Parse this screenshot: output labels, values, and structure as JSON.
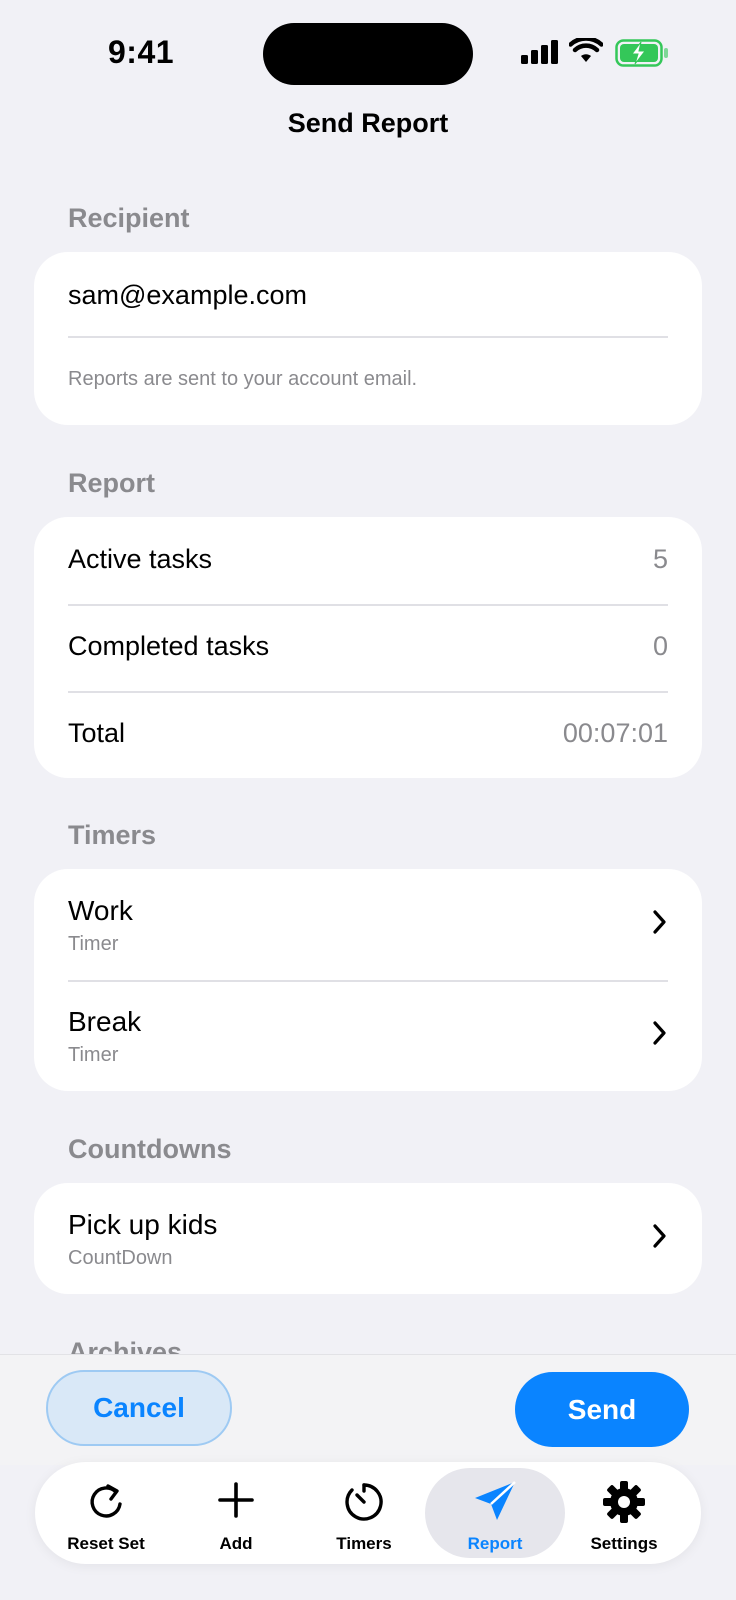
{
  "status_bar": {
    "time": "9:41"
  },
  "nav": {
    "title": "Send Report"
  },
  "recipient": {
    "header": "Recipient",
    "email": "sam@example.com",
    "hint": "Reports are sent to your account email."
  },
  "report": {
    "header": "Report",
    "rows": [
      {
        "label": "Active tasks",
        "value": "5"
      },
      {
        "label": "Completed tasks",
        "value": "0"
      },
      {
        "label": "Total",
        "value": "00:07:01"
      }
    ]
  },
  "timers": {
    "header": "Timers",
    "items": [
      {
        "title": "Work",
        "subtitle": "Timer"
      },
      {
        "title": "Break",
        "subtitle": "Timer"
      }
    ]
  },
  "countdowns": {
    "header": "Countdowns",
    "items": [
      {
        "title": "Pick up kids",
        "subtitle": "CountDown"
      }
    ]
  },
  "archives": {
    "header": "Archives"
  },
  "actions": {
    "cancel": "Cancel",
    "send": "Send"
  },
  "tabbar": {
    "tabs": [
      {
        "label": "Reset Set",
        "icon": "reset-icon"
      },
      {
        "label": "Add",
        "icon": "plus-icon"
      },
      {
        "label": "Timers",
        "icon": "timer-icon"
      },
      {
        "label": "Report",
        "icon": "paper-plane-icon",
        "active": true
      },
      {
        "label": "Settings",
        "icon": "gear-icon"
      }
    ]
  },
  "colors": {
    "accent": "#0a84ff",
    "background": "#f1f1f6",
    "battery": "#34c759"
  }
}
